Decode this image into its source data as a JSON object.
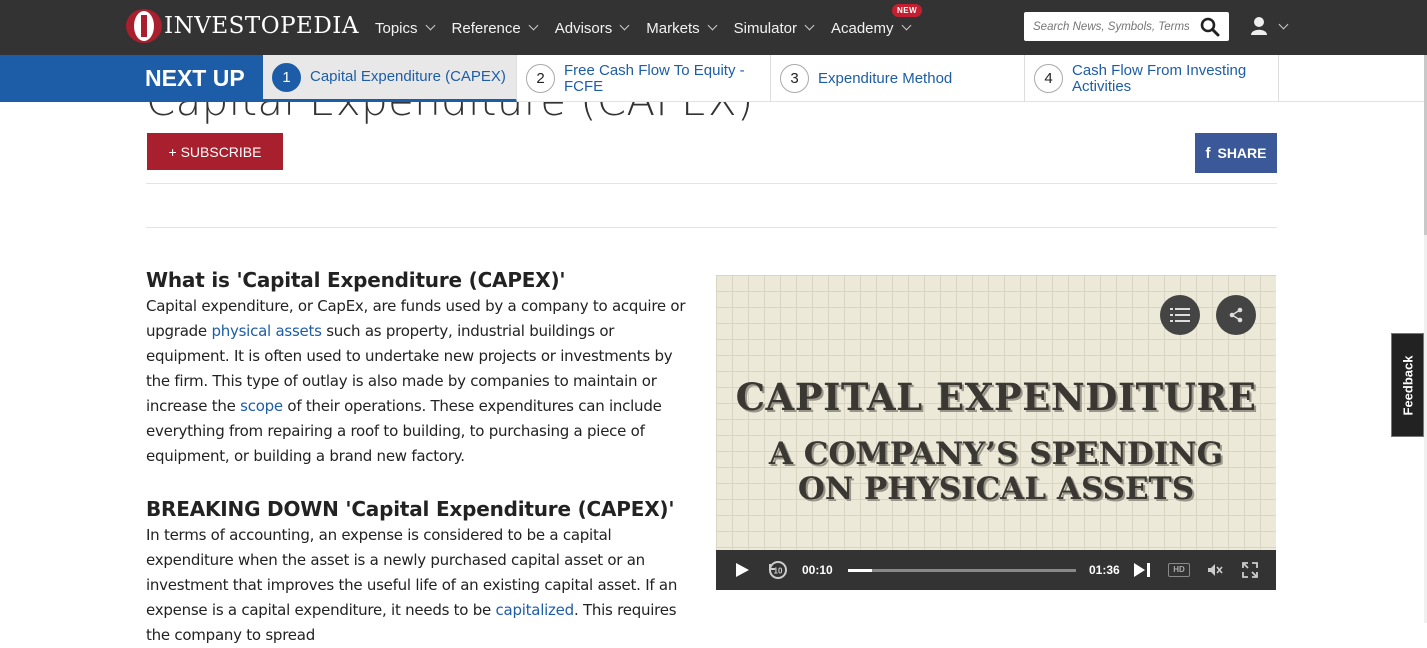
{
  "header": {
    "logo_text": "INVESTOPEDIA",
    "nav": [
      {
        "label": "Topics"
      },
      {
        "label": "Reference"
      },
      {
        "label": "Advisors"
      },
      {
        "label": "Markets"
      },
      {
        "label": "Simulator"
      },
      {
        "label": "Academy",
        "badge": "NEW"
      }
    ],
    "search_placeholder": "Search News, Symbols, Terms",
    "user_icon": "user-icon"
  },
  "next_up": {
    "label": "NEXT UP",
    "items": [
      {
        "num": "1",
        "title": "Capital Expenditure (CAPEX)"
      },
      {
        "num": "2",
        "title": "Free Cash Flow To Equity - FCFE"
      },
      {
        "num": "3",
        "title": "Expenditure Method"
      },
      {
        "num": "4",
        "title": "Cash Flow From Investing Activities"
      }
    ]
  },
  "page": {
    "title": "Capital Expenditure (CAPEX)",
    "subscribe_label": "+ SUBSCRIBE",
    "share_label": "SHARE",
    "share_icon_glyph": "f"
  },
  "article": {
    "h1": "What is 'Capital Expenditure (CAPEX)'",
    "p1": {
      "t1": "Capital expenditure, or CapEx, are funds used by a company to acquire or upgrade ",
      "link1": "physical assets",
      "t2": " such as property, industrial buildings or equipment. It is often used to undertake new projects or investments by the firm. This type of outlay is also made by companies to maintain or increase the ",
      "link2": "scope",
      "t3": " of their operations. These expenditures can include everything from repairing a roof to building, to purchasing a piece of equipment, or building a brand new factory."
    },
    "h2": "BREAKING DOWN 'Capital Expenditure (CAPEX)'",
    "p2": {
      "t1": "In terms of accounting, an expense is considered to be a capital expenditure when the asset is a newly purchased capital asset or an investment that improves the useful life of an existing capital asset. If an expense is a capital expenditure, it needs to be ",
      "link1": "capitalized",
      "t2": ". This requires the company to spread"
    }
  },
  "video": {
    "title": "CAPITAL EXPENDITURE",
    "subtitle_line1": "A COMPANY’S SPENDING",
    "subtitle_line2": "ON PHYSICAL ASSETS",
    "current_time": "00:10",
    "duration": "01:36",
    "progress_fraction": 0.104,
    "hd_label": "HD"
  },
  "feedback_label": "Feedback",
  "colors": {
    "topbar": "#333333",
    "brand_red": "#a81f2d",
    "link_blue": "#1d5da8",
    "facebook": "#3b5998"
  }
}
